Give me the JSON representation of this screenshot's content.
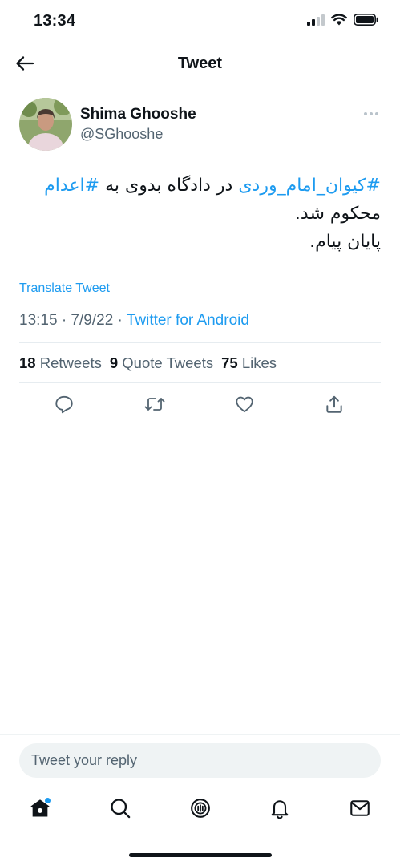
{
  "status_bar": {
    "time": "13:34",
    "icons": [
      "cellular-signal-icon",
      "wifi-icon",
      "battery-icon"
    ]
  },
  "header": {
    "title": "Tweet",
    "back_icon": "back-arrow-icon"
  },
  "tweet": {
    "author": {
      "name": "Shima Ghooshe",
      "handle": "@SGhooshe"
    },
    "body": {
      "line1_hashtag_a": "#کیوان_امام_وردی",
      "line1_text": " در دادگاه بدوی به ",
      "line1_hashtag_b": "#اعدام",
      "line2": "محکوم شد.",
      "line3": "پایان پیام."
    },
    "translate_label": "Translate Tweet",
    "timestamp": "13:15 · 7/9/22 · ",
    "source": "Twitter for Android",
    "stats": {
      "retweets_count": "18",
      "retweets_label": "Retweets",
      "quotes_count": "9",
      "quotes_label": "Quote Tweets",
      "likes_count": "75",
      "likes_label": "Likes"
    },
    "actions": [
      "reply-icon",
      "retweet-icon",
      "like-icon",
      "share-icon"
    ]
  },
  "reply": {
    "placeholder": "Tweet your reply"
  },
  "bottom_nav": {
    "items": [
      "home-icon",
      "search-icon",
      "spaces-icon",
      "notifications-icon",
      "messages-icon"
    ],
    "accent_color": "#1d9bf0"
  },
  "colors": {
    "link": "#1d9bf0",
    "text_primary": "#0f1419",
    "text_secondary": "#536471"
  }
}
